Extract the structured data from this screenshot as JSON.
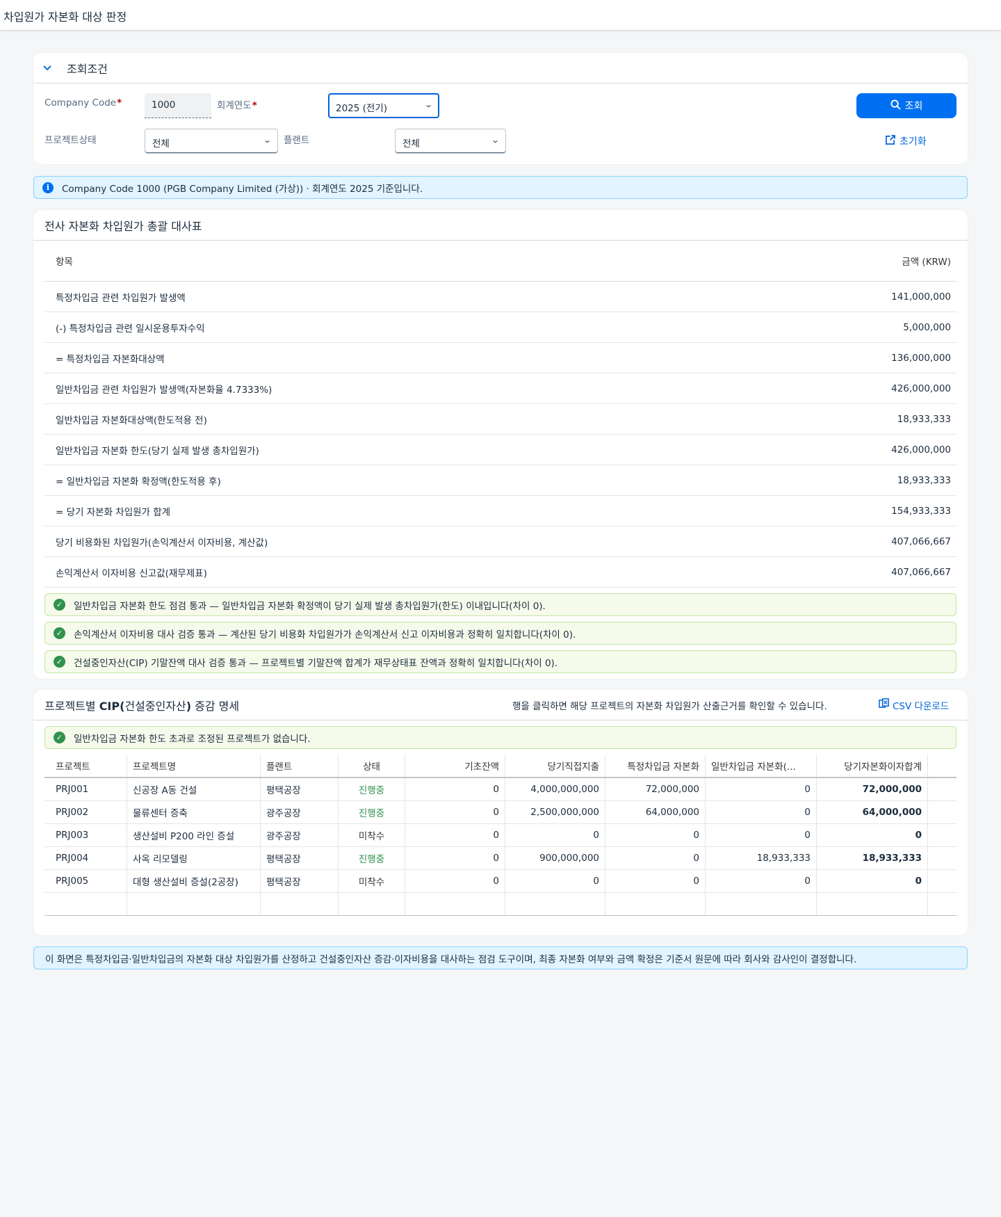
{
  "app": {
    "title": "차입원가 자본화 대상 판정"
  },
  "filter": {
    "header": "조회조건",
    "company_code_label": "Company Code",
    "company_code_value": "1000",
    "fiscal_year_label": "회계연도",
    "fiscal_year_value": "2025 (전기)",
    "project_status_label": "프로젝트상태",
    "project_status_value": "전체",
    "plant_label": "플랜트",
    "plant_value": "전체",
    "search_button": "조회",
    "reset_button": "초기화"
  },
  "info": {
    "message": "Company Code 1000 (PGB Company Limited (가상)) · 회계연도 2025 기준입니다."
  },
  "summary": {
    "title": "전사 자본화 차입원가 총괄 대사표",
    "col_item": "항목",
    "col_amount": "금액 (KRW)",
    "rows": [
      {
        "label": "특정차입금 관련 차입원가 발생액",
        "amount": "141,000,000"
      },
      {
        "label": "(-) 특정차입금 관련 일시운용투자수익",
        "amount": "5,000,000"
      },
      {
        "label": "= 특정차입금 자본화대상액",
        "amount": "136,000,000"
      },
      {
        "label": "일반차입금 관련 차입원가 발생액(자본화율 4.7333%)",
        "amount": "426,000,000"
      },
      {
        "label": "일반차입금 자본화대상액(한도적용 전)",
        "amount": "18,933,333"
      },
      {
        "label": "일반차입금 자본화 한도(당기 실제 발생 총차입원가)",
        "amount": "426,000,000"
      },
      {
        "label": "= 일반차입금 자본화 확정액(한도적용 후)",
        "amount": "18,933,333"
      },
      {
        "label": "= 당기 자본화 차입원가 합계",
        "amount": "154,933,333"
      },
      {
        "label": "당기 비용화된 차입원가(손익계산서 이자비용, 계산값)",
        "amount": "407,066,667"
      },
      {
        "label": "손익계산서 이자비용 신고값(재무제표)",
        "amount": "407,066,667"
      }
    ],
    "checks": [
      "일반차입금 자본화 한도 점검 통과 — 일반차입금 자본화 확정액이 당기 실제 발생 총차입원가(한도) 이내입니다(차이 0).",
      "손익계산서 이자비용 대사 검증 통과 — 계산된 당기 비용화 차입원가가 손익계산서 신고 이자비용과 정확히 일치합니다(차이 0).",
      "건설중인자산(CIP) 기말잔액 대사 검증 통과 — 프로젝트별 기말잔액 합계가 재무상태표 잔액과 정확히 일치합니다(차이 0)."
    ]
  },
  "cip": {
    "title_prefix": "프로젝트별 ",
    "title_bold": "CIP(",
    "title_mid": "건설중인자산",
    "title_bold2": ")",
    "title_suffix": " 증감 명세",
    "hint": "행을 클릭하면 해당 프로젝트의 자본화 차입원가 산출근거를 확인할 수 있습니다.",
    "csv_label": "CSV 다운로드",
    "notice": "일반차입금 자본화 한도 초과로 조정된 프로젝트가 없습니다.",
    "columns": [
      "프로젝트",
      "프로젝트명",
      "플랜트",
      "상태",
      "기초잔액",
      "당기직접지출",
      "특정차입금 자본화",
      "일반차입금 자본화(...",
      "당기자본화이자합계"
    ],
    "rows": [
      {
        "id": "PRJ001",
        "name": "신공장 A동 건설",
        "plant": "평택공장",
        "status": "진행중",
        "status_kind": "progress",
        "opening": "0",
        "direct": "4,000,000,000",
        "specific": "72,000,000",
        "general": "0",
        "total": "72,000,000"
      },
      {
        "id": "PRJ002",
        "name": "물류센터 증축",
        "plant": "광주공장",
        "status": "진행중",
        "status_kind": "progress",
        "opening": "0",
        "direct": "2,500,000,000",
        "specific": "64,000,000",
        "general": "0",
        "total": "64,000,000"
      },
      {
        "id": "PRJ003",
        "name": "생산설비 P200 라인 증설",
        "plant": "광주공장",
        "status": "미착수",
        "status_kind": "notstarted",
        "opening": "0",
        "direct": "0",
        "specific": "0",
        "general": "0",
        "total": "0"
      },
      {
        "id": "PRJ004",
        "name": "사옥 리모델링",
        "plant": "평택공장",
        "status": "진행중",
        "status_kind": "progress",
        "opening": "0",
        "direct": "900,000,000",
        "specific": "0",
        "general": "18,933,333",
        "total": "18,933,333"
      },
      {
        "id": "PRJ005",
        "name": "대형 생산설비 증설(2공장)",
        "plant": "평택공장",
        "status": "미착수",
        "status_kind": "notstarted",
        "opening": "0",
        "direct": "0",
        "specific": "0",
        "general": "0",
        "total": "0"
      }
    ]
  },
  "footer": {
    "message": "이 화면은 특정차입금·일반차입금의 자본화 대상 차입원가를 산정하고 건설중인자산 증감·이자비용을 대사하는 점검 도구이며, 최종 자본화 여부와 금액 확정은 기준서 원문에 따라 회사와 감사인이 결정합니다."
  },
  "colors": {
    "accent": "#0070f2",
    "success": "#30914c",
    "info_bg": "#e1f4ff",
    "success_bg": "#f5faeb"
  }
}
